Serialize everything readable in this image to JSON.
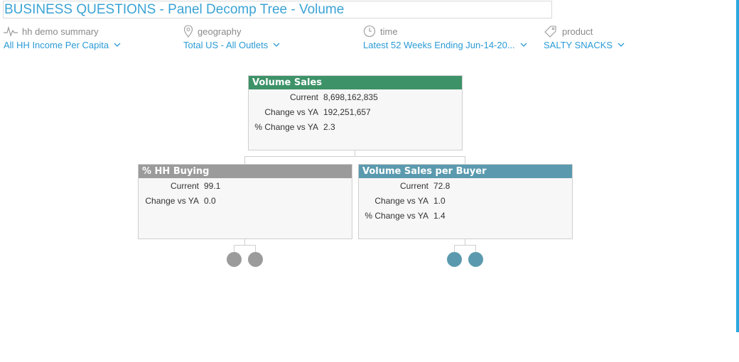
{
  "header": {
    "title": "BUSINESS QUESTIONS - Panel Decomp Tree - Volume"
  },
  "filters": [
    {
      "label": "hh demo summary",
      "value": "All HH Income Per Capita",
      "icon": "pulse-icon"
    },
    {
      "label": "geography",
      "value": "Total US - All Outlets",
      "icon": "location-pin-icon"
    },
    {
      "label": "time",
      "value": "Latest 52 Weeks Ending Jun-14-20...",
      "icon": "clock-icon"
    },
    {
      "label": "product",
      "value": "SALTY SNACKS",
      "icon": "tag-icon"
    }
  ],
  "tree": {
    "root": {
      "title": "Volume Sales",
      "color": "#3d9268",
      "metrics": [
        {
          "label": "Current",
          "value": "8,698,162,835"
        },
        {
          "label": "Change vs YA",
          "value": "192,251,657"
        },
        {
          "label": "% Change vs YA",
          "value": "2.3"
        }
      ]
    },
    "left": {
      "title": "% HH Buying",
      "color": "#9b9b9b",
      "metrics": [
        {
          "label": "Current",
          "value": "99.1"
        },
        {
          "label": "Change vs YA",
          "value": "0.0"
        }
      ]
    },
    "right": {
      "title": "Volume Sales per Buyer",
      "color": "#5b9aae",
      "metrics": [
        {
          "label": "Current",
          "value": "72.8"
        },
        {
          "label": "Change vs YA",
          "value": "1.0"
        },
        {
          "label": "% Change vs YA",
          "value": "1.4"
        }
      ]
    }
  },
  "colors": {
    "accent": "#2a9bd6",
    "left_dot": "#9b9b9b",
    "right_dot": "#5b9aae"
  }
}
